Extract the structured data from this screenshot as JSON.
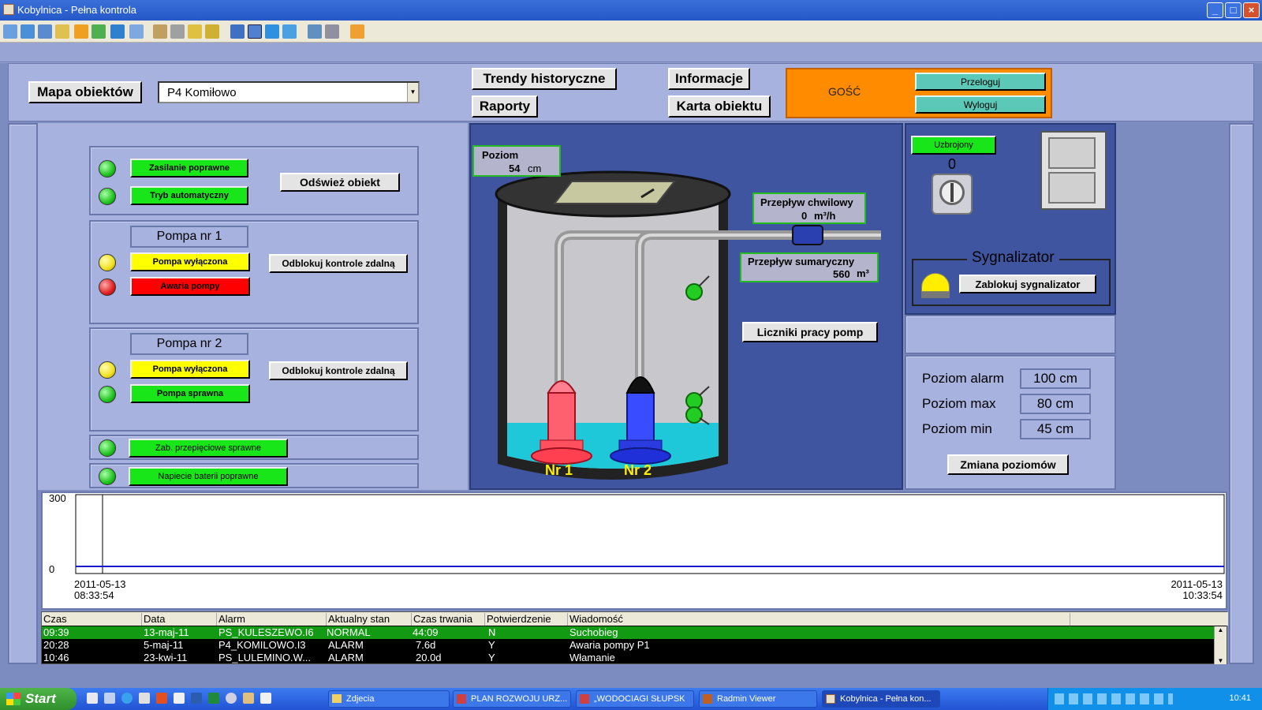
{
  "window": {
    "title": "Kobylnica - Pełna kontrola"
  },
  "topbar": {
    "map_button": "Mapa obiektów",
    "object_select": "P4 Komiłowo",
    "trends_button": "Trendy historyczne",
    "reports_button": "Raporty",
    "info_button": "Informacje",
    "card_button": "Karta obiektu",
    "user_label": "GOŚĆ",
    "relogin_button": "Przeloguj",
    "logout_button": "Wyloguj"
  },
  "left": {
    "power_status": "Zasilanie poprawne",
    "mode_status": "Tryb automatyczny",
    "refresh_button": "Odśwież obiekt",
    "pump1": {
      "title": "Pompa nr 1",
      "state": "Pompa wyłączona",
      "fault": "Awaria pompy",
      "unlock": "Odblokuj kontrole zdalną"
    },
    "pump2": {
      "title": "Pompa nr 2",
      "state": "Pompa wyłączona",
      "fault": "Pompa sprawna",
      "unlock": "Odblokuj kontrole zdalną"
    },
    "surge_status": "Zab. przepięciowe sprawne",
    "battery_status": "Napiecie baterii poprawne"
  },
  "center": {
    "level_label": "Poziom",
    "level_value": "54",
    "level_unit": "cm",
    "flow_label": "Przepływ chwilowy",
    "flow_value": "0",
    "flow_unit": "m³/h",
    "total_label": "Przepływ sumaryczny",
    "total_value": "560",
    "total_unit": "m³",
    "counters_button": "Liczniki pracy pomp",
    "pump1_label": "Nr 1",
    "pump2_label": "Nr 2"
  },
  "right": {
    "armed_status": "Uzbrojony",
    "armed_count": "0",
    "siren_title": "Sygnalizator",
    "siren_button": "Zablokuj sygnalizator",
    "alarm_level_label": "Poziom alarm",
    "alarm_level_value": "100 cm",
    "max_level_label": "Poziom max",
    "max_level_value": "80 cm",
    "min_level_label": "Poziom min",
    "min_level_value": "45 cm",
    "change_button": "Zmiana poziomów"
  },
  "chart_data": {
    "type": "line",
    "ylim": [
      0,
      300
    ],
    "y_ticks": [
      "300",
      "0"
    ],
    "x_start_date": "2011-05-13",
    "x_start_time": "08:33:54",
    "x_end_date": "2011-05-13",
    "x_end_time": "10:33:54",
    "series": [
      {
        "values": [
          0,
          0
        ]
      }
    ],
    "color": "#1a1acc"
  },
  "alarms": {
    "columns": [
      "Czas",
      "Data",
      "Alarm",
      "Aktualny stan",
      "Czas trwania",
      "Potwierdzenie",
      "Wiadomość"
    ],
    "rows": [
      {
        "time": "09:39",
        "date": "13-maj-11",
        "alarm": "PS_KULESZEWO.I6",
        "state": "NORMAL",
        "duration": "44:09",
        "ack": "N",
        "msg": "Suchobieg"
      },
      {
        "time": "20:28",
        "date": "5-maj-11",
        "alarm": "P4_KOMILOWO.I3",
        "state": "ALARM",
        "duration": "7.6d",
        "ack": "Y",
        "msg": "Awaria pompy P1"
      },
      {
        "time": "10:46",
        "date": "23-kwi-11",
        "alarm": "PS_LULEMINO.W...",
        "state": "ALARM",
        "duration": "20.0d",
        "ack": "Y",
        "msg": "Włamanie"
      }
    ]
  },
  "taskbar": {
    "start": "Start",
    "tasks": [
      "Zdjecia",
      "PLAN ROZWOJU URZ...",
      "„WODOCIAGI SŁUPSK",
      "Radmin Viewer",
      "Kobylnica - Pełna kon..."
    ],
    "clock": "10:41"
  },
  "colors": {
    "ok": "#19e619",
    "warn": "#ffff00",
    "fault": "#ff0000",
    "guest": "#ff8c00"
  }
}
